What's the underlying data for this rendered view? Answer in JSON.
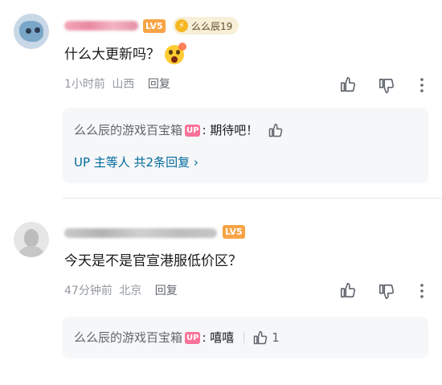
{
  "comments": [
    {
      "level_badge": "LV5",
      "medal": {
        "coin": "⚡",
        "text": "么么辰19"
      },
      "content": "什么大更新吗？",
      "emoji": "😲",
      "time": "1小时前",
      "location": "山西",
      "reply_label": "回复",
      "sub_replies": [
        {
          "author": "么么辰的游戏百宝箱",
          "badge": "UP",
          "text": ": 期待吧！",
          "likes": ""
        }
      ],
      "more_link": "UP 主等人 共2条回复 ›"
    },
    {
      "level_badge": "LV5",
      "content": "今天是不是官宣港服低价区？",
      "time": "47分钟前",
      "location": "北京",
      "reply_label": "回复",
      "sub_replies": [
        {
          "author": "么么辰的游戏百宝箱",
          "badge": "UP",
          "text": ": 嘻嘻",
          "likes": "1"
        }
      ]
    }
  ],
  "icons": [
    "thumbs-up-icon",
    "thumbs-down-icon",
    "more-vertical-icon"
  ],
  "colors": {
    "level": "#f8a446",
    "up_badge": "#fb7299",
    "link": "#00699d",
    "meta": "#9499a0",
    "sub_bg": "#f6f7f8"
  }
}
